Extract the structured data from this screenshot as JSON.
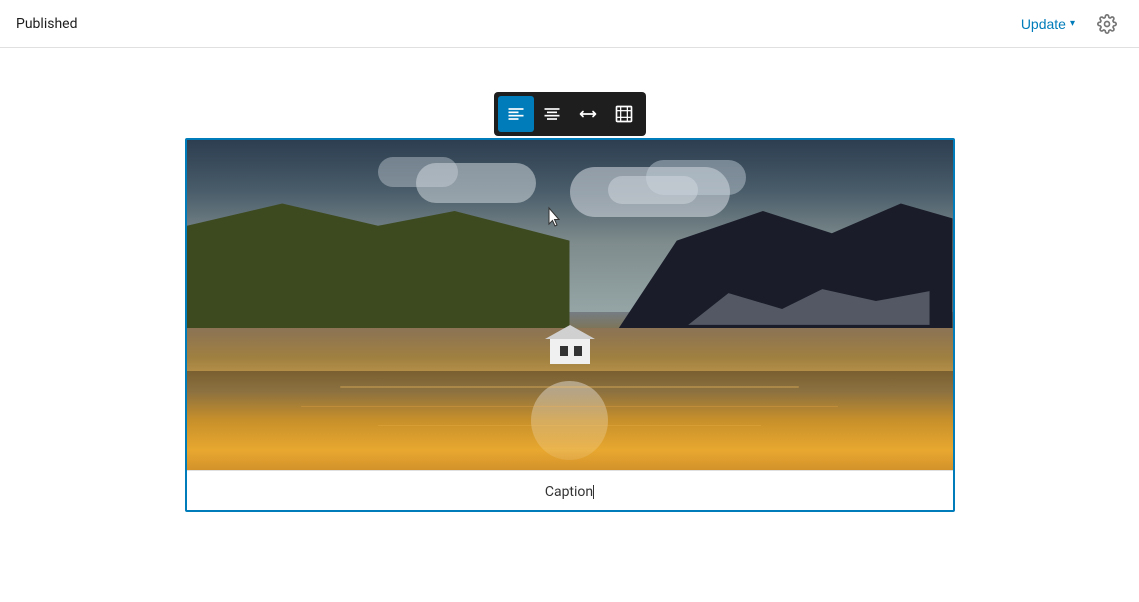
{
  "header": {
    "published_label": "Published",
    "update_button_label": "Update",
    "chevron": "▾",
    "settings_icon": "⚙"
  },
  "toolbar": {
    "buttons": [
      {
        "id": "align-left",
        "label": "Align left",
        "active": true,
        "unicode": "≡"
      },
      {
        "id": "align-center",
        "label": "Align center",
        "active": false,
        "unicode": "≡"
      },
      {
        "id": "wide-width",
        "label": "Wide width",
        "active": false,
        "unicode": "↔"
      },
      {
        "id": "full-width",
        "label": "Full width",
        "active": false,
        "unicode": "⛶"
      }
    ]
  },
  "image": {
    "caption": "Caption"
  },
  "colors": {
    "accent": "#007cba",
    "toolbar_bg": "#1e1e1e",
    "border_active": "#007cba"
  }
}
